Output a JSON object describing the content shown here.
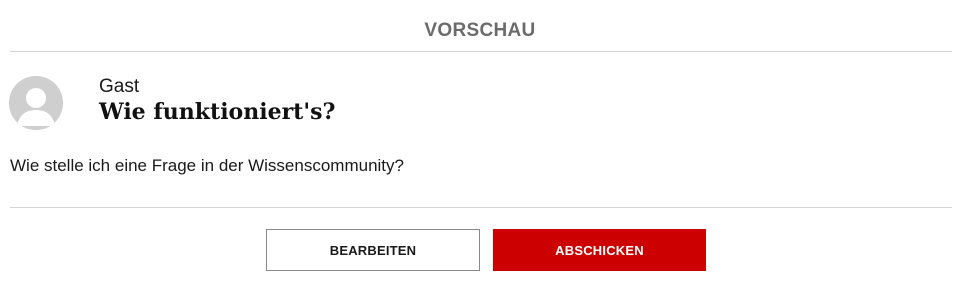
{
  "header": {
    "title": "VORSCHAU"
  },
  "post": {
    "author": "Gast",
    "avatar_icon": "default-user-avatar-icon",
    "title": "Wie funktioniert's?",
    "body": "Wie stelle ich eine Frage in der Wissenscommunity?"
  },
  "actions": {
    "edit_label": "BEARBEITEN",
    "submit_label": "ABSCHICKEN"
  },
  "colors": {
    "accent": "#cc0000",
    "header_text": "#6b6b6b",
    "divider": "#d4d4d4",
    "avatar_bg": "#cfcfcf"
  }
}
